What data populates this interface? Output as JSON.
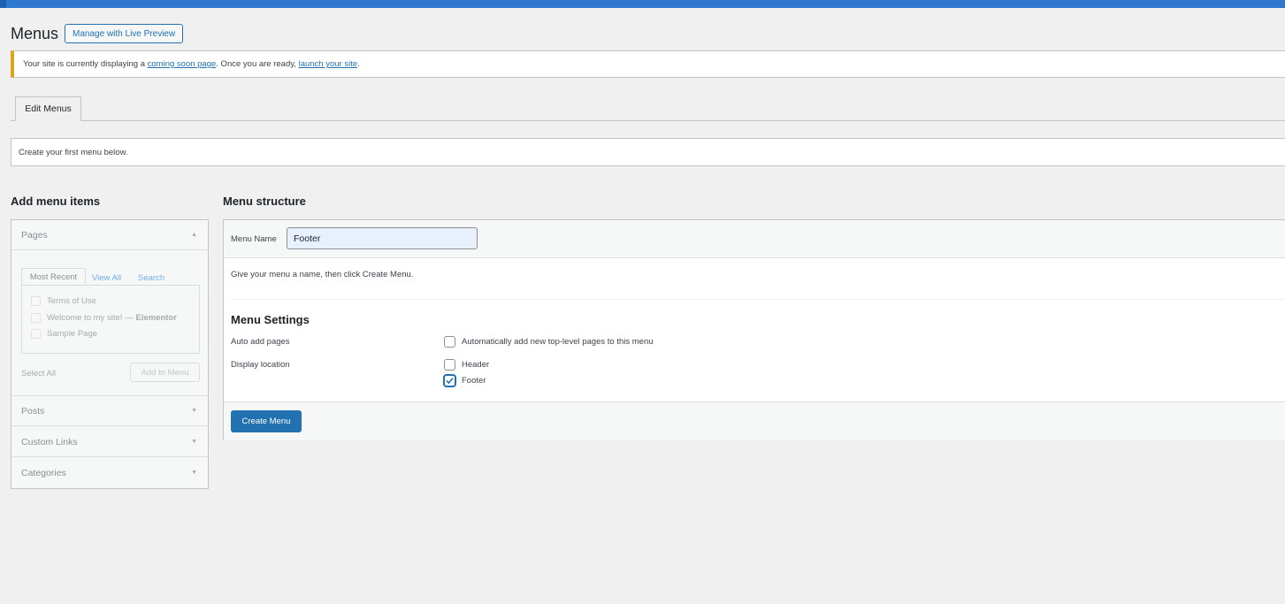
{
  "header": {
    "title": "Menus",
    "live_preview_label": "Manage with Live Preview"
  },
  "notice": {
    "text_before": "Your site is currently displaying a ",
    "link1": "coming soon page",
    "text_middle": ". Once you are ready, ",
    "link2": "launch your site",
    "text_after": "."
  },
  "tabs": {
    "edit_menus": "Edit Menus"
  },
  "info": {
    "text": "Create your first menu below."
  },
  "add_items": {
    "heading": "Add menu items",
    "pages": {
      "label": "Pages",
      "tabs": [
        "Most Recent",
        "View All",
        "Search"
      ],
      "items": [
        {
          "title": "Terms of Use",
          "suffix": ""
        },
        {
          "title": "Welcome to my site! — ",
          "suffix": "Elementor"
        },
        {
          "title": "Sample Page",
          "suffix": ""
        }
      ],
      "select_all": "Select All",
      "add_button": "Add to Menu"
    },
    "posts_label": "Posts",
    "custom_links_label": "Custom Links",
    "categories_label": "Categories"
  },
  "menu_structure": {
    "heading": "Menu structure",
    "name_label": "Menu Name",
    "name_value": "Footer",
    "hint": "Give your menu a name, then click Create Menu.",
    "settings_title": "Menu Settings",
    "auto_add_label": "Auto add pages",
    "auto_add_option": "Automatically add new top-level pages to this menu",
    "display_location_label": "Display location",
    "locations": [
      {
        "label": "Header",
        "checked": false
      },
      {
        "label": "Footer",
        "checked": true
      }
    ],
    "create_button": "Create Menu"
  },
  "colors": {
    "admin_blue": "#2271b1",
    "topbar": "#2e78d2",
    "notice_warning": "#dba617"
  }
}
